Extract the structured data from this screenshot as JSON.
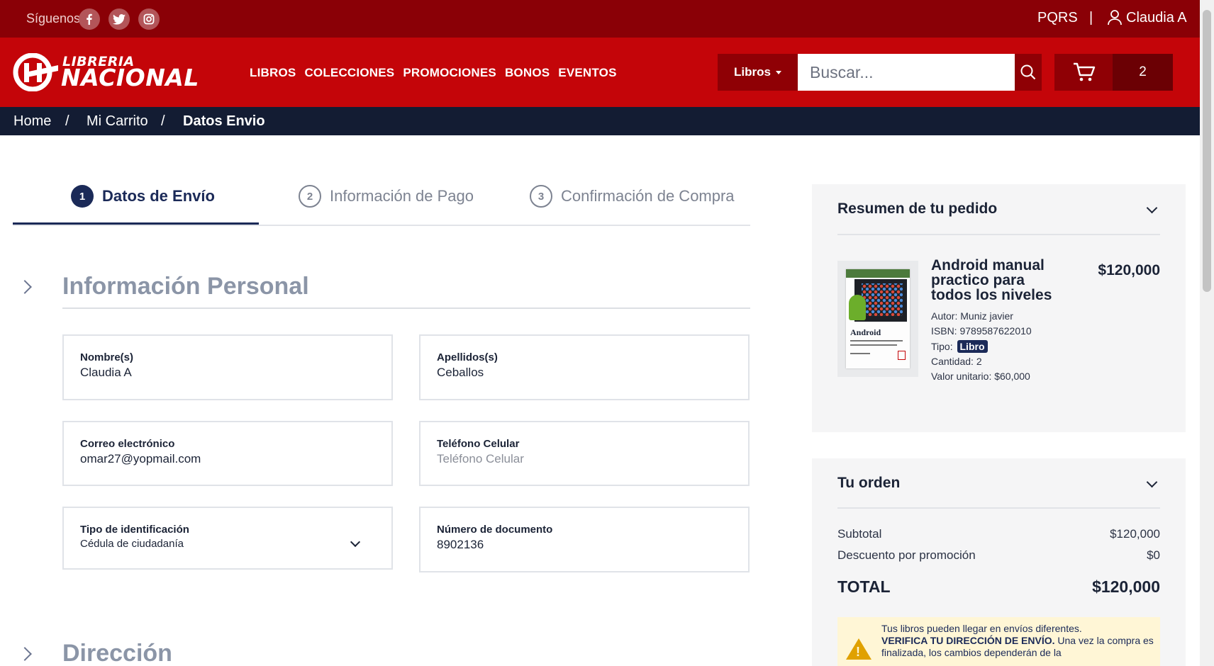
{
  "topbar": {
    "follow_label": "Síguenos",
    "social_icons": [
      "facebook-icon",
      "twitter-icon",
      "instagram-icon"
    ],
    "pqrs": "PQRS",
    "separator": "|",
    "user_name": "Claudia A"
  },
  "header": {
    "logo_top": "LIBRERIA",
    "logo_main": "NACIONAL",
    "nav": [
      "LIBROS",
      "COLECCIONES",
      "PROMOCIONES",
      "BONOS",
      "EVENTOS"
    ],
    "category_select": "Libros",
    "search_placeholder": "Buscar...",
    "cart_count": "2"
  },
  "breadcrumb": {
    "home": "Home",
    "sep": "/",
    "cart": "Mi Carrito",
    "current": "Datos Envio"
  },
  "steps": [
    {
      "number": "1",
      "label": "Datos de Envío",
      "active": true
    },
    {
      "number": "2",
      "label": "Información de Pago",
      "active": false
    },
    {
      "number": "3",
      "label": "Confirmación de Compra",
      "active": false
    }
  ],
  "personal": {
    "title": "Información Personal",
    "fields": {
      "nombre": {
        "label": "Nombre(s)",
        "value": "Claudia A"
      },
      "apellidos": {
        "label": "Apellidos(s)",
        "value": "Ceballos"
      },
      "correo": {
        "label": "Correo electrónico",
        "value": "omar27@yopmail.com"
      },
      "telefono": {
        "label": "Teléfono Celular",
        "value": "",
        "placeholder": "Teléfono Celular"
      },
      "tipo_id": {
        "label": "Tipo de identificación",
        "value": "Cédula de ciudadanía"
      },
      "documento": {
        "label": "Número de documento",
        "value": "8902136"
      }
    }
  },
  "address": {
    "title": "Dirección"
  },
  "summary": {
    "title": "Resumen de tu pedido",
    "product": {
      "cover_title": "Android",
      "title": "Android manual practico para todos los niveles",
      "price": "$120,000",
      "author": "Autor: Muniz javier",
      "isbn": "ISBN: 9789587622010",
      "tipo_label": "Tipo:",
      "tipo_badge": "Libro",
      "cantidad": "Cantidad: 2",
      "unit_value": "Valor unitario: $60,000"
    }
  },
  "order": {
    "title": "Tu orden",
    "subtotal_label": "Subtotal",
    "subtotal_value": "$120,000",
    "discount_label": "Descuento por promoción",
    "discount_value": "$0",
    "total_label": "TOTAL",
    "total_value": "$120,000",
    "notice_line1": "Tus libros pueden llegar en envíos diferentes.",
    "notice_bold": "VERIFICA TU DIRECCIÓN DE ENVÍO.",
    "notice_rest": "Una vez la compra es finalizada, los cambios dependerán de la"
  },
  "colors": {
    "topbar": "#8a0006",
    "header": "#c40509",
    "breadcrumb": "#131c33",
    "accent_navy": "#1b2a58"
  }
}
